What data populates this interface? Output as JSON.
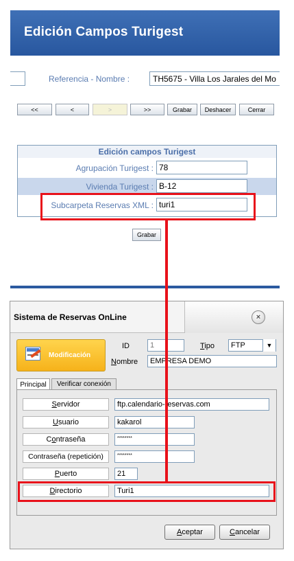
{
  "top": {
    "title": "Edición Campos Turigest",
    "reference_label": "Referencia - Nombre :",
    "reference_value": "TH5675 - Villa Los Jarales del Mo",
    "nav_buttons": {
      "first": "<<",
      "prev": "<",
      "next": ">",
      "last": ">>"
    },
    "grabar": "Grabar",
    "deshacer": "Deshacer",
    "cerrar": "Cerrar",
    "form": {
      "title": "Edición campos Turigest",
      "rows": [
        {
          "label": "Agrupación Turigest :",
          "value": "78"
        },
        {
          "label": "Vivienda Turigest :",
          "value": "B-12"
        },
        {
          "label": "Subcarpeta Reservas XML :",
          "value": "turi1"
        }
      ]
    },
    "form_save": "Grabar"
  },
  "dialog": {
    "title": "Sistema de Reservas OnLine",
    "close_symbol": "×",
    "mode": "Modificación",
    "id_label": "ID",
    "id_value": "1",
    "tipo_label_u": "T",
    "tipo_label_rest": "ipo",
    "tipo_value": "FTP",
    "nombre_label_u": "N",
    "nombre_label_rest": "ombre",
    "nombre_value": "EMPRESA DEMO",
    "tabs": [
      "Principal",
      "Verificar conexión"
    ],
    "fields": {
      "servidor": {
        "u": "S",
        "rest": "ervidor",
        "value": "ftp.calendario-reservas.com"
      },
      "usuario": {
        "u": "U",
        "rest": "suario",
        "value": "kakarol"
      },
      "contrasena": {
        "pre": "C",
        "u": "o",
        "rest": "ntraseña",
        "value": "********"
      },
      "contrasena_rep": {
        "label": "Contraseña (repetición)",
        "value": "********"
      },
      "puerto": {
        "u": "P",
        "rest": "uerto",
        "value": "21"
      },
      "directorio": {
        "u": "D",
        "rest": "irectorio",
        "value": "Turi1"
      }
    },
    "aceptar": {
      "u": "A",
      "rest": "ceptar"
    },
    "cancelar": {
      "u": "C",
      "rest": "ancelar"
    }
  },
  "colors": {
    "header_blue": "#28579f",
    "highlight_red": "#e8111a",
    "mode_yellow": "#f6b21a",
    "row_blue": "#c9d7ec"
  },
  "icons": {
    "mode": "edit-document-icon",
    "close": "close-icon",
    "dropdown": "chevron-down-icon"
  }
}
